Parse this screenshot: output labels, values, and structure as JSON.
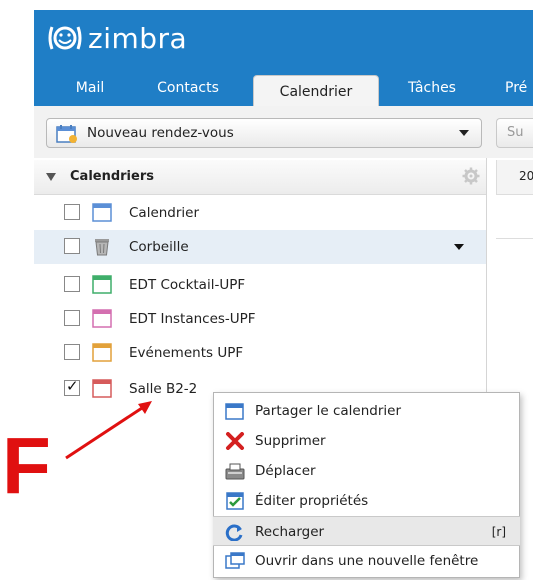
{
  "app": {
    "brand": "zimbra"
  },
  "tabs": [
    {
      "label": "Mail",
      "active": false
    },
    {
      "label": "Contacts",
      "active": false
    },
    {
      "label": "Calendrier",
      "active": true
    },
    {
      "label": "Tâches",
      "active": false
    },
    {
      "label": "Pré",
      "active": false
    }
  ],
  "toolbar": {
    "new_appointment_label": "Nouveau rendez-vous",
    "right_button_label": "Su"
  },
  "calendars_panel": {
    "title": "Calendriers",
    "items": [
      {
        "label": "Calendrier",
        "checked": false,
        "icon": "calendar-blue-icon",
        "color": "#5b8fd6"
      },
      {
        "label": "Corbeille",
        "checked": false,
        "icon": "trash-icon",
        "selected": true
      },
      {
        "label": "EDT Cocktail-UPF",
        "checked": false,
        "icon": "calendar-green-icon",
        "color": "#3fae6a"
      },
      {
        "label": "EDT Instances-UPF",
        "checked": false,
        "icon": "calendar-pink-icon",
        "color": "#d46fb0"
      },
      {
        "label": "Evénements UPF",
        "checked": false,
        "icon": "calendar-orange-icon",
        "color": "#e2a13a"
      },
      {
        "label": "Salle B2-2",
        "checked": true,
        "icon": "calendar-red-icon",
        "color": "#d65b5b"
      }
    ]
  },
  "right_strip": {
    "header_text": "20"
  },
  "context_menu": {
    "items": [
      {
        "label": "Partager le calendrier",
        "icon": "share-calendar-icon",
        "shortcut": ""
      },
      {
        "label": "Supprimer",
        "icon": "delete-x-icon",
        "shortcut": ""
      },
      {
        "label": "Déplacer",
        "icon": "move-icon",
        "shortcut": ""
      },
      {
        "label": "Éditer propriétés",
        "icon": "edit-properties-icon",
        "shortcut": ""
      },
      {
        "label": "Recharger",
        "icon": "reload-icon",
        "shortcut": "[r]",
        "highlighted": true
      },
      {
        "label": "Ouvrir dans une nouvelle fenêtre",
        "icon": "new-window-icon",
        "shortcut": ""
      }
    ]
  },
  "annotation": {
    "letter": "F",
    "color": "#e01010"
  },
  "colors": {
    "header": "#1f7ec6",
    "selection": "#e6eef6"
  }
}
